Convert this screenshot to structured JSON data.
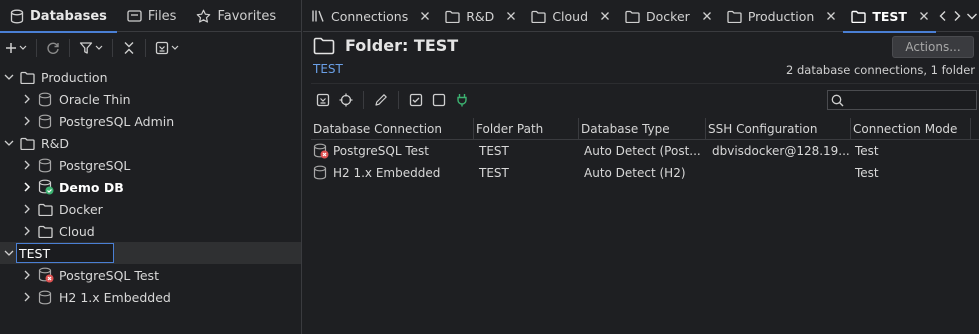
{
  "left_tabs": [
    {
      "label": "Databases",
      "icon": "database-icon",
      "active": true
    },
    {
      "label": "Files",
      "icon": "files-icon",
      "active": false
    },
    {
      "label": "Favorites",
      "icon": "star-icon",
      "active": false
    }
  ],
  "tree": {
    "folders": [
      {
        "label": "Production",
        "children": [
          "Oracle Thin",
          "PostgreSQL Admin"
        ]
      },
      {
        "label": "R&D",
        "children": [
          "PostgreSQL",
          "Demo DB",
          "Docker",
          "Cloud"
        ]
      },
      {
        "label": "TEST",
        "children": [
          "PostgreSQL Test",
          "H2 1.x Embedded"
        ]
      }
    ],
    "editing_value": "TEST"
  },
  "editor_tabs": [
    {
      "label": "Connections"
    },
    {
      "label": "R&D"
    },
    {
      "label": "Cloud"
    },
    {
      "label": "Docker"
    },
    {
      "label": "Production"
    },
    {
      "label": "TEST"
    }
  ],
  "folder": {
    "title": "Folder: TEST",
    "path": "TEST",
    "summary": "2 database connections, 1 folder",
    "actions_label": "Actions..."
  },
  "grid": {
    "columns": [
      "Database Connection",
      "Folder Path",
      "Database Type",
      "SSH Configuration",
      "Connection Mode"
    ],
    "rows": [
      {
        "name": "PostgreSQL Test",
        "folder": "TEST",
        "type": "Auto Detect (Post...",
        "ssh": "dbvisdocker@128.19...",
        "mode": "Test"
      },
      {
        "name": "H2 1.x Embedded",
        "folder": "TEST",
        "type": "Auto Detect (H2)",
        "ssh": "",
        "mode": "Test"
      }
    ]
  },
  "colors": {
    "accent": "#4a7fd4",
    "connected": "#3cb371",
    "error": "#e05252",
    "link": "#6a9fe6"
  }
}
